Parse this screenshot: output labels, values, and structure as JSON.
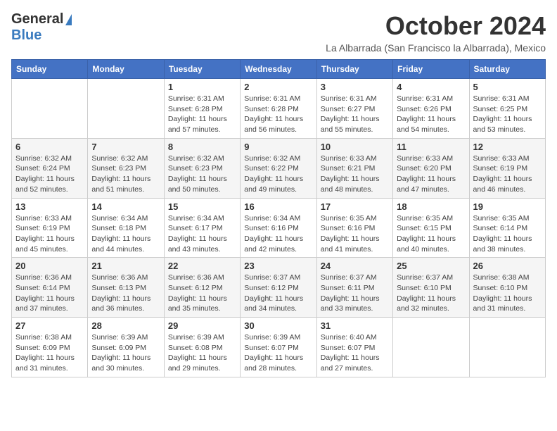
{
  "header": {
    "logo_general": "General",
    "logo_blue": "Blue",
    "month_title": "October 2024",
    "subtitle": "La Albarrada (San Francisco la Albarrada), Mexico"
  },
  "calendar": {
    "days_of_week": [
      "Sunday",
      "Monday",
      "Tuesday",
      "Wednesday",
      "Thursday",
      "Friday",
      "Saturday"
    ],
    "weeks": [
      [
        {
          "day": "",
          "info": ""
        },
        {
          "day": "",
          "info": ""
        },
        {
          "day": "1",
          "info": "Sunrise: 6:31 AM\nSunset: 6:28 PM\nDaylight: 11 hours and 57 minutes."
        },
        {
          "day": "2",
          "info": "Sunrise: 6:31 AM\nSunset: 6:28 PM\nDaylight: 11 hours and 56 minutes."
        },
        {
          "day": "3",
          "info": "Sunrise: 6:31 AM\nSunset: 6:27 PM\nDaylight: 11 hours and 55 minutes."
        },
        {
          "day": "4",
          "info": "Sunrise: 6:31 AM\nSunset: 6:26 PM\nDaylight: 11 hours and 54 minutes."
        },
        {
          "day": "5",
          "info": "Sunrise: 6:31 AM\nSunset: 6:25 PM\nDaylight: 11 hours and 53 minutes."
        }
      ],
      [
        {
          "day": "6",
          "info": "Sunrise: 6:32 AM\nSunset: 6:24 PM\nDaylight: 11 hours and 52 minutes."
        },
        {
          "day": "7",
          "info": "Sunrise: 6:32 AM\nSunset: 6:23 PM\nDaylight: 11 hours and 51 minutes."
        },
        {
          "day": "8",
          "info": "Sunrise: 6:32 AM\nSunset: 6:23 PM\nDaylight: 11 hours and 50 minutes."
        },
        {
          "day": "9",
          "info": "Sunrise: 6:32 AM\nSunset: 6:22 PM\nDaylight: 11 hours and 49 minutes."
        },
        {
          "day": "10",
          "info": "Sunrise: 6:33 AM\nSunset: 6:21 PM\nDaylight: 11 hours and 48 minutes."
        },
        {
          "day": "11",
          "info": "Sunrise: 6:33 AM\nSunset: 6:20 PM\nDaylight: 11 hours and 47 minutes."
        },
        {
          "day": "12",
          "info": "Sunrise: 6:33 AM\nSunset: 6:19 PM\nDaylight: 11 hours and 46 minutes."
        }
      ],
      [
        {
          "day": "13",
          "info": "Sunrise: 6:33 AM\nSunset: 6:19 PM\nDaylight: 11 hours and 45 minutes."
        },
        {
          "day": "14",
          "info": "Sunrise: 6:34 AM\nSunset: 6:18 PM\nDaylight: 11 hours and 44 minutes."
        },
        {
          "day": "15",
          "info": "Sunrise: 6:34 AM\nSunset: 6:17 PM\nDaylight: 11 hours and 43 minutes."
        },
        {
          "day": "16",
          "info": "Sunrise: 6:34 AM\nSunset: 6:16 PM\nDaylight: 11 hours and 42 minutes."
        },
        {
          "day": "17",
          "info": "Sunrise: 6:35 AM\nSunset: 6:16 PM\nDaylight: 11 hours and 41 minutes."
        },
        {
          "day": "18",
          "info": "Sunrise: 6:35 AM\nSunset: 6:15 PM\nDaylight: 11 hours and 40 minutes."
        },
        {
          "day": "19",
          "info": "Sunrise: 6:35 AM\nSunset: 6:14 PM\nDaylight: 11 hours and 38 minutes."
        }
      ],
      [
        {
          "day": "20",
          "info": "Sunrise: 6:36 AM\nSunset: 6:14 PM\nDaylight: 11 hours and 37 minutes."
        },
        {
          "day": "21",
          "info": "Sunrise: 6:36 AM\nSunset: 6:13 PM\nDaylight: 11 hours and 36 minutes."
        },
        {
          "day": "22",
          "info": "Sunrise: 6:36 AM\nSunset: 6:12 PM\nDaylight: 11 hours and 35 minutes."
        },
        {
          "day": "23",
          "info": "Sunrise: 6:37 AM\nSunset: 6:12 PM\nDaylight: 11 hours and 34 minutes."
        },
        {
          "day": "24",
          "info": "Sunrise: 6:37 AM\nSunset: 6:11 PM\nDaylight: 11 hours and 33 minutes."
        },
        {
          "day": "25",
          "info": "Sunrise: 6:37 AM\nSunset: 6:10 PM\nDaylight: 11 hours and 32 minutes."
        },
        {
          "day": "26",
          "info": "Sunrise: 6:38 AM\nSunset: 6:10 PM\nDaylight: 11 hours and 31 minutes."
        }
      ],
      [
        {
          "day": "27",
          "info": "Sunrise: 6:38 AM\nSunset: 6:09 PM\nDaylight: 11 hours and 31 minutes."
        },
        {
          "day": "28",
          "info": "Sunrise: 6:39 AM\nSunset: 6:09 PM\nDaylight: 11 hours and 30 minutes."
        },
        {
          "day": "29",
          "info": "Sunrise: 6:39 AM\nSunset: 6:08 PM\nDaylight: 11 hours and 29 minutes."
        },
        {
          "day": "30",
          "info": "Sunrise: 6:39 AM\nSunset: 6:07 PM\nDaylight: 11 hours and 28 minutes."
        },
        {
          "day": "31",
          "info": "Sunrise: 6:40 AM\nSunset: 6:07 PM\nDaylight: 11 hours and 27 minutes."
        },
        {
          "day": "",
          "info": ""
        },
        {
          "day": "",
          "info": ""
        }
      ]
    ]
  }
}
